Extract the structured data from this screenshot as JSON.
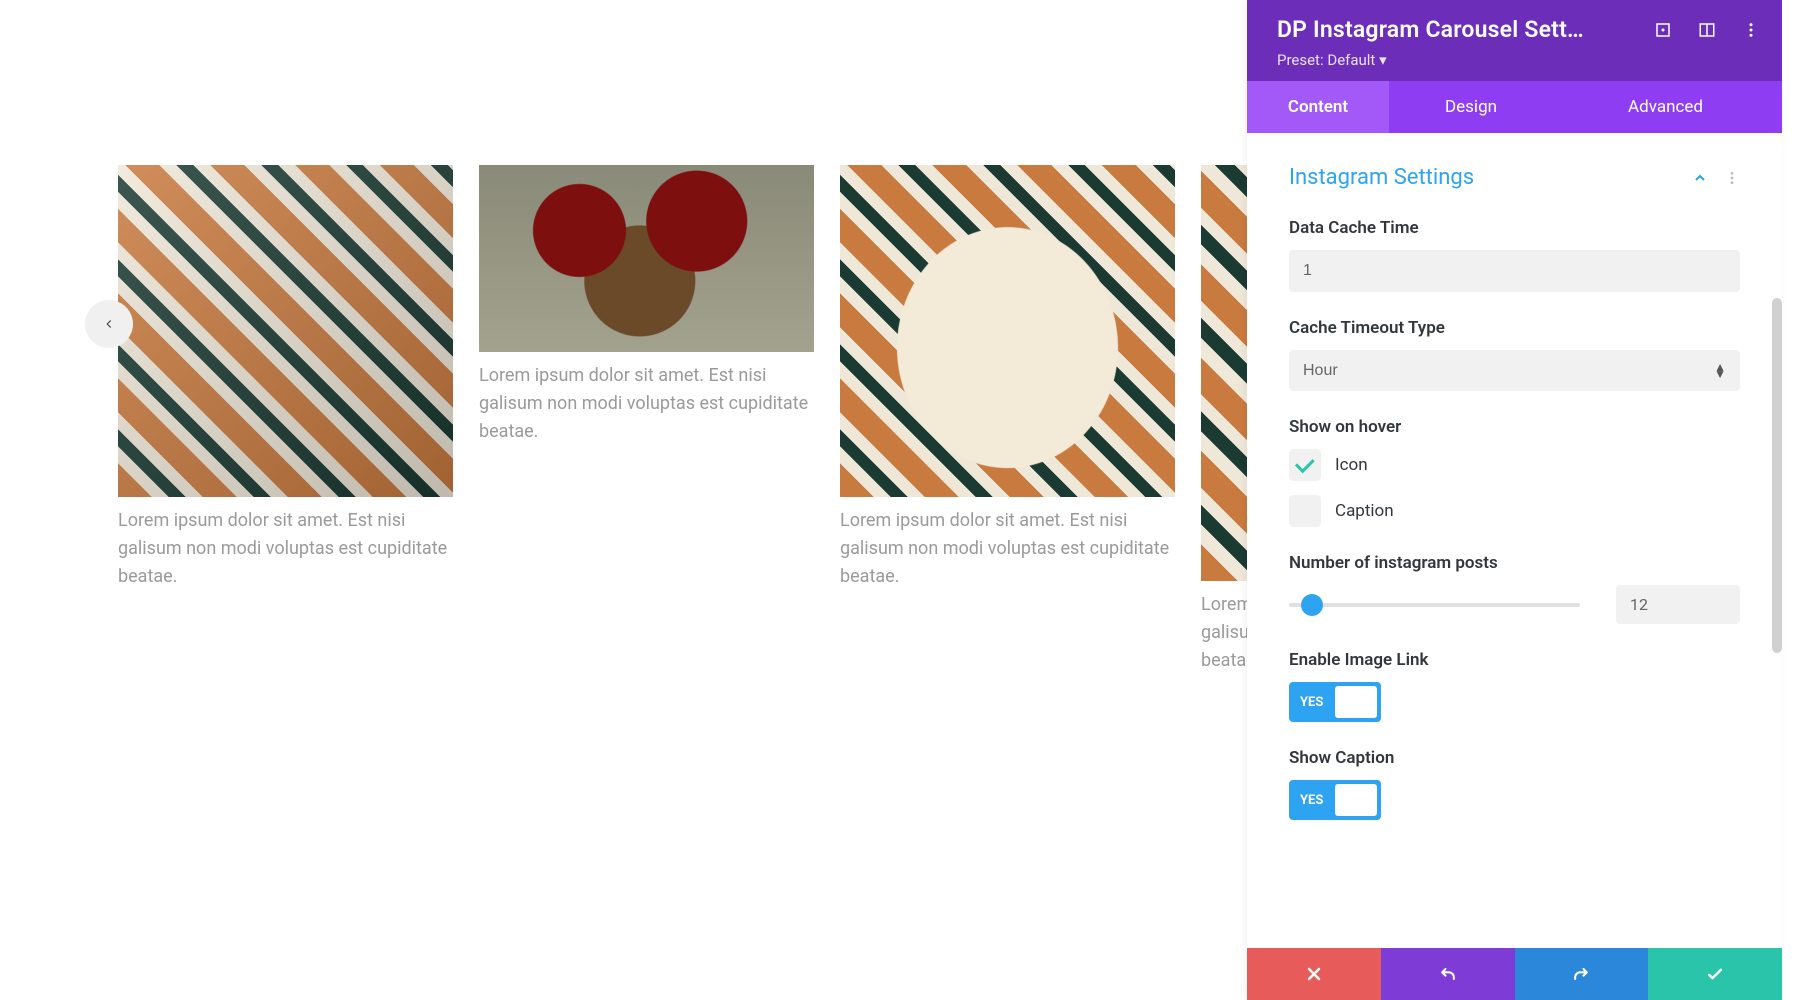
{
  "carousel": {
    "items": [
      {
        "caption": "Lorem ipsum dolor sit amet. Est nisi galisum non modi voluptas est cupiditate beatae."
      },
      {
        "caption": "Lorem ipsum dolor sit amet. Est nisi galisum non modi voluptas est cupiditate beatae."
      },
      {
        "caption": "Lorem ipsum dolor sit amet. Est nisi galisum non modi voluptas est cupiditate beatae."
      },
      {
        "caption": "Lorem ipsum dolor sit amet. Est nisi galisum non modi voluptas est cupiditate beatae."
      }
    ]
  },
  "panel": {
    "title": "DP Instagram Carousel Sett…",
    "preset_label": "Preset:",
    "preset_value": "Default",
    "tabs": {
      "content": "Content",
      "design": "Design",
      "advanced": "Advanced"
    },
    "section": {
      "title": "Instagram Settings"
    },
    "fields": {
      "data_cache_time": {
        "label": "Data Cache Time",
        "value": "1"
      },
      "cache_timeout_type": {
        "label": "Cache Timeout Type",
        "value": "Hour"
      },
      "show_on_hover": {
        "label": "Show on hover",
        "icon": {
          "label": "Icon",
          "checked": true
        },
        "caption": {
          "label": "Caption",
          "checked": false
        }
      },
      "num_posts": {
        "label": "Number of instagram posts",
        "value": "12"
      },
      "enable_image_link": {
        "label": "Enable Image Link",
        "state": "YES"
      },
      "show_caption": {
        "label": "Show Caption",
        "state": "YES"
      }
    }
  },
  "colors": {
    "accent_blue": "#2ea3f2",
    "header_purple": "#6c2eb9",
    "tabs_purple": "#8e3df2",
    "active_tab": "#a259f7",
    "danger": "#e85b5b",
    "success": "#29c4a9",
    "redo_blue": "#2b87da"
  }
}
